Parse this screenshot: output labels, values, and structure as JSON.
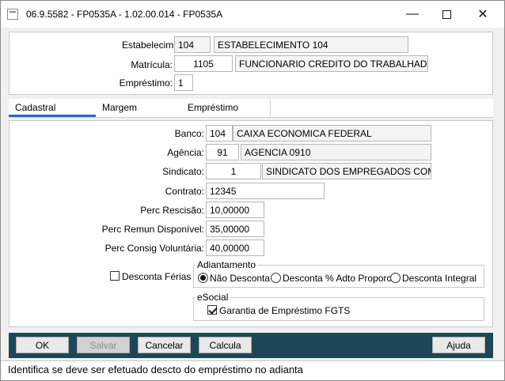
{
  "window": {
    "title": "06.9.5582 - FP0535A - 1.02.00.014 - FP0535A",
    "minimize_glyph": "—",
    "close_glyph": "✕"
  },
  "header": {
    "estabelecimento_label": "Estabelecimento:",
    "estabelecimento_code": "104",
    "estabelecimento_name": "ESTABELECIMENTO 104",
    "matricula_label": "Matrícula:",
    "matricula_code": "1105",
    "matricula_name": "FUNCIONARIO CREDITO  DO TRABALHADOR",
    "emprestimo_label": "Empréstimo:",
    "emprestimo_value": "1"
  },
  "tabs": [
    {
      "label": "Cadastral",
      "active": true
    },
    {
      "label": "Margem",
      "active": false
    },
    {
      "label": "Empréstimo",
      "active": false
    }
  ],
  "form": {
    "banco_label": "Banco:",
    "banco_code": "104",
    "banco_name": "CAIXA ECONOMICA FEDERAL",
    "agencia_label": "Agência:",
    "agencia_code": "91",
    "agencia_name": "AGENCIA 0910",
    "sindicato_label": "Sindicato:",
    "sindicato_code": "1",
    "sindicato_name": "SINDICATO DOS EMPREGADOS COM LOND",
    "contrato_label": "Contrato:",
    "contrato_value": "12345",
    "perc_rescisao_label": "Perc Rescisão:",
    "perc_rescisao_value": "10,00000",
    "perc_remun_label": "Perc Remun Disponível:",
    "perc_remun_value": "35,00000",
    "perc_consig_label": "Perc Consig Voluntária:",
    "perc_consig_value": "40,00000",
    "desconta_ferias_label": "Desconta Férias",
    "desconta_ferias_checked": false
  },
  "adiantamento": {
    "title": "Adiantamento",
    "options": [
      {
        "label": "Não Desconta",
        "selected": true
      },
      {
        "label": "Desconta % Adto Proporc",
        "selected": false
      },
      {
        "label": "Desconta Integral",
        "selected": false
      }
    ]
  },
  "esocial": {
    "title": "eSocial",
    "garantia_label": "Garantia de Empréstimo FGTS",
    "garantia_checked": true
  },
  "buttons": {
    "ok": "OK",
    "salvar": "Salvar",
    "cancelar": "Cancelar",
    "calcula": "Calcula",
    "ajuda": "Ajuda"
  },
  "status": {
    "text": "Identifica se deve ser efetuado descto do empréstimo no adianta"
  }
}
